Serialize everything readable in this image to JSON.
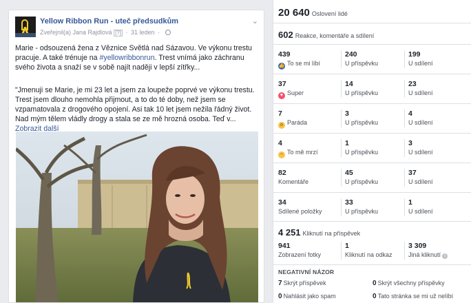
{
  "post": {
    "page_name": "Yellow Ribbon Run - uteč předsudkům",
    "published_by": "Zveřejnil(a) Jana Rajdlová",
    "help": "[?]",
    "date": "31 leden",
    "text1_a": "Marie - odsouzená žena z Věznice Světlá nad Sázavou. Ve výkonu trestu pracuje. A také trénuje na ",
    "hashtag": "#yellowribbonrun",
    "text1_b": ". Trest vnímá jako záchranu svého života a snaží se v sobě najít naději v lepší zítřky...",
    "text2": "\"Jmenuji se Marie, je mi 23 let a jsem za loupeže poprvé ve výkonu trestu. Trest jsem dlouho nemohla přijmout, a to do té doby, než jsem se vzpamatovala z drogového opojení. Asi tak 10 let jsem nežila řádný život. Nad mým tělem vládly drogy a stala se ze mě hrozná osoba. Teď v...",
    "see_more": "Zobrazit další"
  },
  "insights": {
    "reach": {
      "value": "20 640",
      "label": "Oslovení lidé"
    },
    "engagement": {
      "value": "602",
      "label": "Reakce, komentáře a sdílení"
    },
    "rows": [
      {
        "icon": "like",
        "c1": "439",
        "c1_label": "To se mi líbí",
        "c2": "240",
        "c2_label": "U příspěvku",
        "c3": "199",
        "c3_label": "U sdílení"
      },
      {
        "icon": "love",
        "c1": "37",
        "c1_label": "Super",
        "c2": "14",
        "c2_label": "U příspěvku",
        "c3": "23",
        "c3_label": "U sdílení"
      },
      {
        "icon": "haha",
        "c1": "7",
        "c1_label": "Paráda",
        "c2": "3",
        "c2_label": "U příspěvku",
        "c3": "4",
        "c3_label": "U sdílení"
      },
      {
        "icon": "sad",
        "c1": "4",
        "c1_label": "To mě mrzí",
        "c2": "1",
        "c2_label": "U příspěvku",
        "c3": "3",
        "c3_label": "U sdílení"
      },
      {
        "icon": "",
        "c1": "82",
        "c1_label": "Komentáře",
        "c2": "45",
        "c2_label": "U příspěvku",
        "c3": "37",
        "c3_label": "U sdílení"
      },
      {
        "icon": "",
        "c1": "34",
        "c1_label": "Sdílené položky",
        "c2": "33",
        "c2_label": "U příspěvku",
        "c3": "1",
        "c3_label": "U sdílení"
      }
    ],
    "clicks": {
      "value": "4 251",
      "label": "Kliknutí na příspěvek"
    },
    "click_breakdown": {
      "c1": "941",
      "c1_label": "Zobrazení fotky",
      "c2": "1",
      "c2_label": "Kliknutí na odkaz",
      "c3": "3 309",
      "c3_label": "Jiná kliknutí"
    },
    "negative": {
      "title": "NEGATIVNÍ NÁZOR",
      "hide_post_n": "7",
      "hide_post": "Skrýt příspěvek",
      "hide_all_n": "0",
      "hide_all": "Skrýt všechny příspěvky",
      "spam_n": "0",
      "spam": "Nahlásit jako spam",
      "unlike_n": "0",
      "unlike": "Tato stránka se mi už nelíbí"
    }
  }
}
